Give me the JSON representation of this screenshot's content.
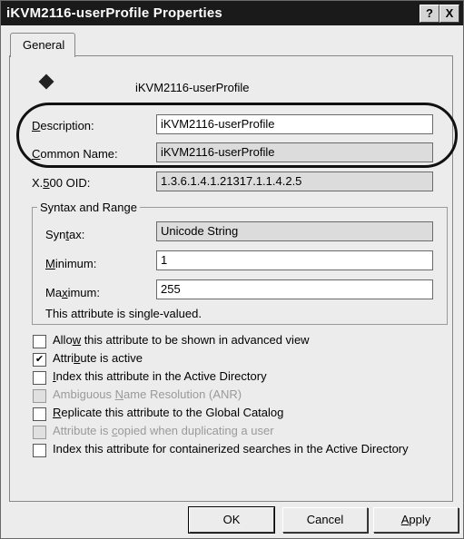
{
  "window": {
    "title": "iKVM2116-userProfile Properties",
    "help_button": "?",
    "close_button": "X"
  },
  "tabs": [
    {
      "label": "General",
      "selected": true
    }
  ],
  "attribute": {
    "name": "iKVM2116-userProfile",
    "icon": "attribute-diamond-icon"
  },
  "fields": {
    "description": {
      "label": "Description:",
      "value": "iKVM2116-userProfile",
      "editable": true
    },
    "common_name": {
      "label": "Common Name:",
      "value": "iKVM2116-userProfile",
      "editable": false
    },
    "oid": {
      "label": "X.500 OID:",
      "value": "1.3.6.1.4.1.21317.1.1.4.2.5",
      "editable": false
    }
  },
  "syntax_group": {
    "title": "Syntax and Range",
    "syntax": {
      "label": "Syntax:",
      "value": "Unicode String"
    },
    "minimum": {
      "label": "Minimum:",
      "value": "1"
    },
    "maximum": {
      "label": "Maximum:",
      "value": "255"
    },
    "note": "This attribute is single-valued."
  },
  "checkboxes": [
    {
      "label": "Allow this attribute to be shown in advanced view",
      "checked": false,
      "enabled": true
    },
    {
      "label": "Attribute is active",
      "checked": true,
      "enabled": true
    },
    {
      "label": "Index this attribute in the Active Directory",
      "checked": false,
      "enabled": true
    },
    {
      "label": "Ambiguous Name Resolution (ANR)",
      "checked": false,
      "enabled": false
    },
    {
      "label": "Replicate this attribute to the Global Catalog",
      "checked": false,
      "enabled": true
    },
    {
      "label": "Attribute is copied when duplicating a user",
      "checked": false,
      "enabled": false
    },
    {
      "label": "Index this attribute for containerized searches in the Active Directory",
      "checked": false,
      "enabled": true
    }
  ],
  "buttons": {
    "ok": "OK",
    "cancel": "Cancel",
    "apply": "Apply"
  },
  "colors": {
    "titlebar": "#1a1a1a",
    "dialog_bg": "#ececec",
    "highlight_oval": "#111111"
  }
}
